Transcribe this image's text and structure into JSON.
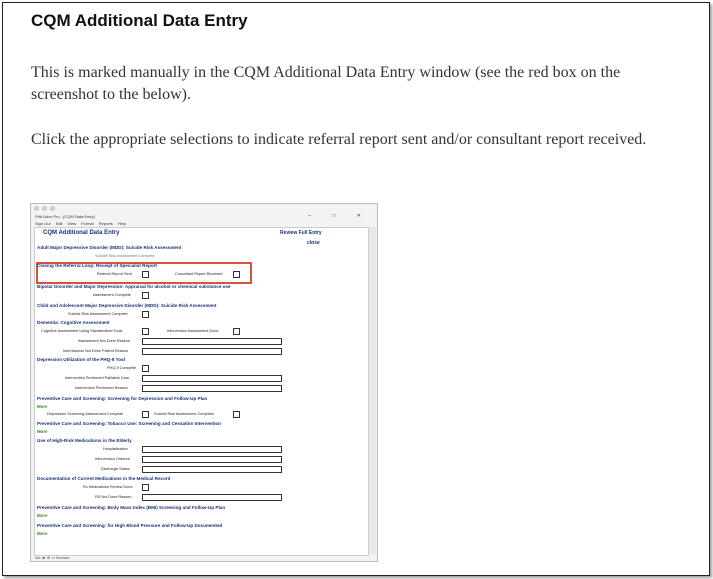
{
  "heading": "CQM Additional Data Entry",
  "paragraph1": "This is marked manually in the CQM Additional Data Entry window (see the red box on the screenshot to the below).",
  "paragraph2": "Click the appropriate selections to indicate referral report sent and/or consultant report received.",
  "screenshot": {
    "window_title": "PrM Advo Pro - [CQM Data Entry]",
    "menu": [
      "Sign Out",
      "Edit",
      "View",
      "Format",
      "Reports",
      "Help"
    ],
    "window_controls": "– □ ✕",
    "form_title": "CQM Additional Data Entry",
    "review_label": "Review Full Entry",
    "close_label": "close",
    "sections": {
      "mdd_suicide": "Adult Major Depressive Disorder (MDD): Suicide Risk Assessment",
      "mdd_suicide_sub": "Suicide Risk Assessment Complete",
      "referral": "Closing the Referral Loop: Receipt of Specialist Report",
      "referral_sent": "Referral Report Sent",
      "consultant_received": "Consultant Report Received",
      "bipolar": "Bipolar Disorder and Major Depression: Appraisal for alcohol or chemical substance use",
      "assessment_complete": "Assessment Complete",
      "child_mdd": "Child and Adolescent Major Depressive Disorder (MDD): Suicide Risk Assessment",
      "child_suicide_complete": "Suicide Risk Assessment Complete",
      "dementia": "Dementia: Cognitive Assessment",
      "cognitive_tools": "Cognitive Assessment Using Standardized Tools",
      "intervention_done": "Intervention Assessment Done",
      "assessment_not_done": "Assessment Not Done Reason",
      "interv_not_done": "Inter/Assess Not Done Patient Reason",
      "phq9": "Depression Utilization of the PHQ-9 Tool",
      "phq9_complete": "PHQ-9 Complete",
      "interv_palliative": "Intervention Performed Palliative Care",
      "interv_reason": "Intervention Performed Reason",
      "screen_depression": "Preventive Care and Screening: Screening for Depression and Follow-Up Plan",
      "more": "More",
      "depression_screen_complete": "Depression Screening Assessment Complete",
      "suicide_risk_complete": "Suicide Risk Assessment Complete",
      "tobacco": "Preventive Care and Screening: Tobacco Use: Screening and Cessation Intervention",
      "high_risk_meds": "Use of High-Risk Medications in the Elderly",
      "hospitalization": "Hospitalization",
      "intervention_ordered": "Intervention Ordered",
      "discharge_status": "Discharge Status",
      "doc_meds": "Documentation of Current Medications in the Medical Record",
      "rx_review": "Rx Medications Review Done",
      "rx_not_done": "RX Not Done Reason",
      "bmi": "Preventive Care and Screening: Body Mass Index (BMI) Screening and Follow-Up Plan",
      "bp": "Preventive Care and Screening: for High Blood Pressure and Follow-Up Documented"
    },
    "status_text": "Ide  ◂▸  ⊕  ▭     Browse"
  }
}
